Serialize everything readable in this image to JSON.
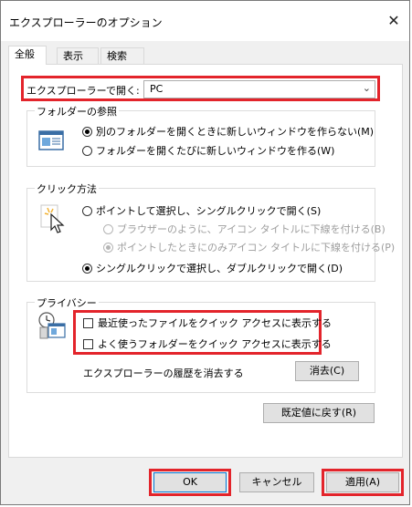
{
  "window": {
    "title": "エクスプローラーのオプション",
    "close_glyph": "✕"
  },
  "tabs": [
    {
      "label": "全般",
      "active": true
    },
    {
      "label": "表示",
      "active": false
    },
    {
      "label": "検索",
      "active": false
    }
  ],
  "open_in": {
    "label": "エクスプローラーで開く:",
    "value": "PC",
    "chevron_glyph": "⌄"
  },
  "browse_folders": {
    "title": "フォルダーの参照",
    "icon": "folder-window-icon",
    "options": [
      {
        "label": "別のフォルダーを開くときに新しいウィンドウを作らない(M)",
        "selected": true
      },
      {
        "label": "フォルダーを開くたびに新しいウィンドウを作る(W)",
        "selected": false
      }
    ]
  },
  "click_items": {
    "title": "クリック方法",
    "icon": "pointer-click-icon",
    "options": [
      {
        "label": "ポイントして選択し、シングルクリックで開く(S)",
        "selected": false,
        "disabled": false
      },
      {
        "label": "ブラウザーのように、アイコン タイトルに下線を付ける(B)",
        "selected": false,
        "disabled": true
      },
      {
        "label": "ポイントしたときにのみアイコン タイトルに下線を付ける(P)",
        "selected": true,
        "disabled": true
      },
      {
        "label": "シングルクリックで選択し、ダブルクリックで開く(D)",
        "selected": true,
        "disabled": false
      }
    ]
  },
  "privacy": {
    "title": "プライバシー",
    "icon": "privacy-history-icon",
    "checks": [
      {
        "label": "最近使ったファイルをクイック アクセスに表示する",
        "checked": false
      },
      {
        "label": "よく使うフォルダーをクイック アクセスに表示する",
        "checked": false
      }
    ],
    "clear_label": "エクスプローラーの履歴を消去する",
    "clear_button": "消去(C)"
  },
  "restore_button": "既定値に戻す(R)",
  "footer": {
    "ok": "OK",
    "cancel": "キャンセル",
    "apply": "適用(A)"
  },
  "colors": {
    "highlight_border": "#e3242b",
    "window_bg": "#f0f0f0",
    "panel_bg": "#ffffff"
  }
}
